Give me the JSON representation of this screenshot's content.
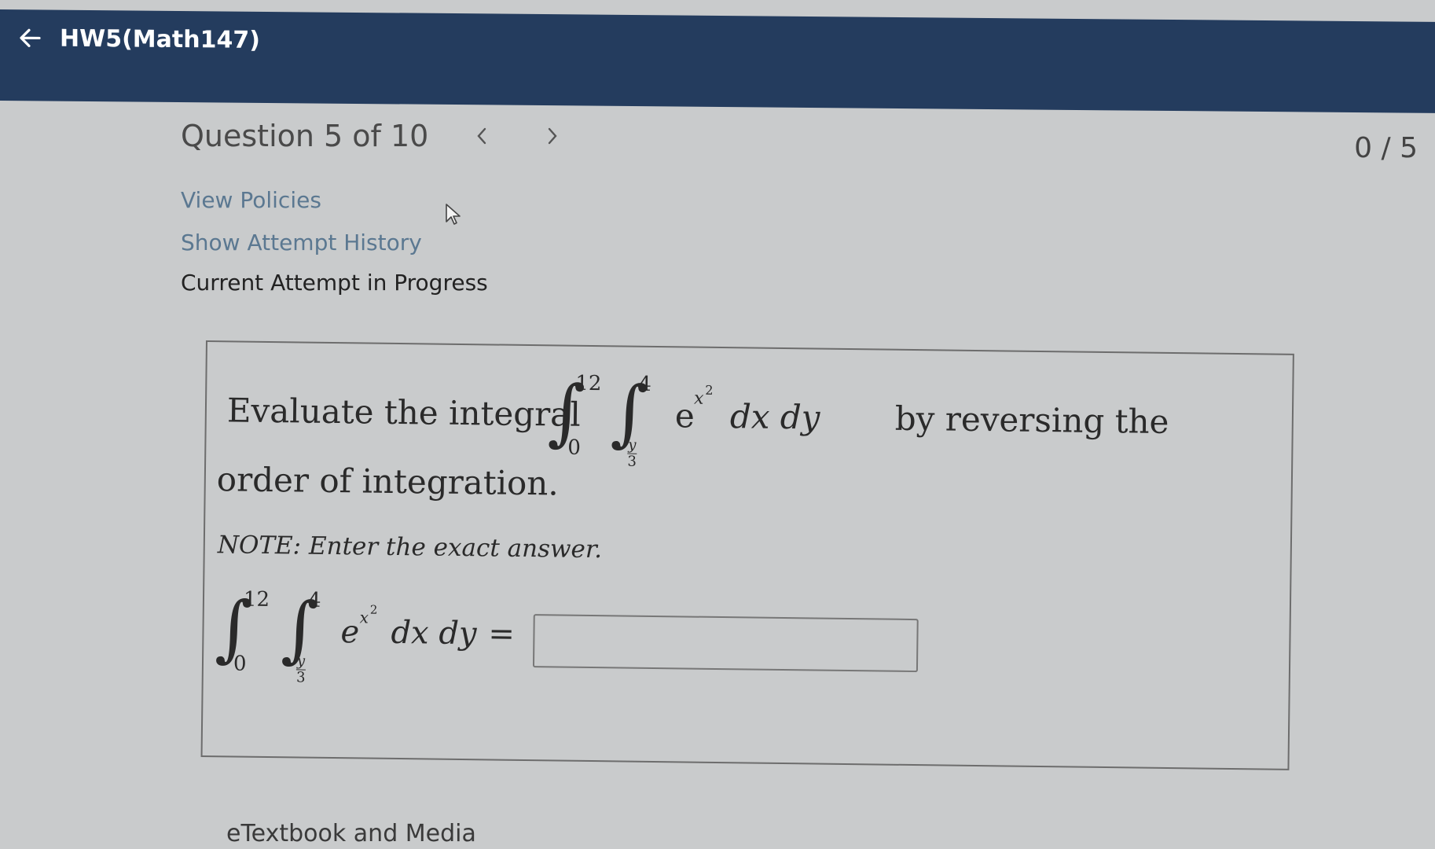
{
  "header": {
    "title": "HW5(Math147)",
    "back_icon": "arrow-left-icon"
  },
  "question": {
    "label": "Question 5 of 10",
    "score": "0 / 5",
    "prev_icon": "chevron-left-icon",
    "next_icon": "chevron-right-icon"
  },
  "links": {
    "view_policies": "View Policies",
    "show_attempt_history": "Show Attempt History"
  },
  "attempt_status": "Current Attempt in Progress",
  "problem": {
    "prompt_before": "Evaluate the integral",
    "outer_upper": "12",
    "outer_lower": "0",
    "inner_upper": "4",
    "inner_lower_num": "y",
    "inner_lower_den": "3",
    "integrand_base": "e",
    "integrand_exp": "x",
    "integrand_exp_power": "2",
    "differentials": "dx dy",
    "prompt_after": "by reversing the",
    "prompt_line2": "order of integration.",
    "note_label": "NOTE:",
    "note_text": "Enter the exact answer.",
    "equals": "=",
    "answer_value": ""
  },
  "footer": {
    "etextbook": "eTextbook and Media"
  }
}
